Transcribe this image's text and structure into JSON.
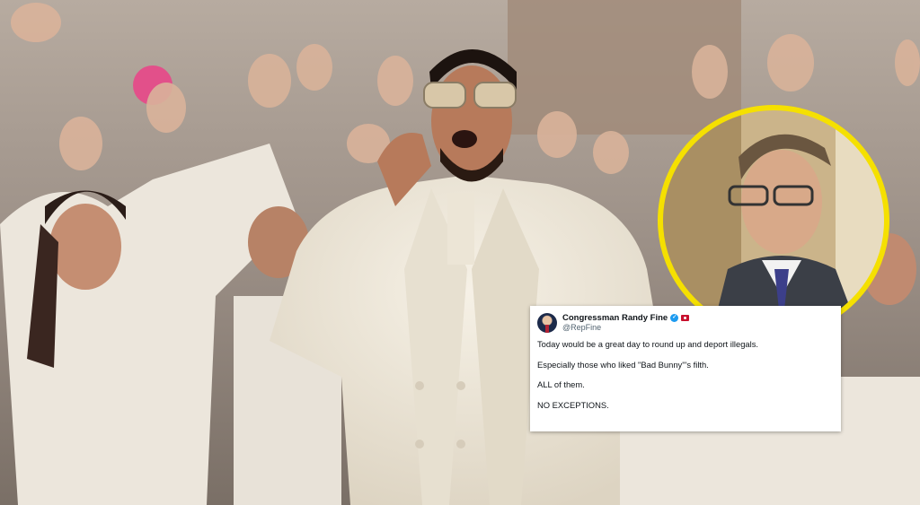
{
  "tweet": {
    "display_name": "Congressman Randy Fine",
    "handle": "@RepFine",
    "lines": [
      "Today would be a great day to round up and deport illegals.",
      "Especially those who liked \"Bad Bunny\"'s filth.",
      "ALL of them.",
      "NO EXCEPTIONS."
    ]
  },
  "colors": {
    "inset_ring": "#f5e000",
    "verified": "#1d9bf0",
    "suit": "#f1ece0"
  }
}
